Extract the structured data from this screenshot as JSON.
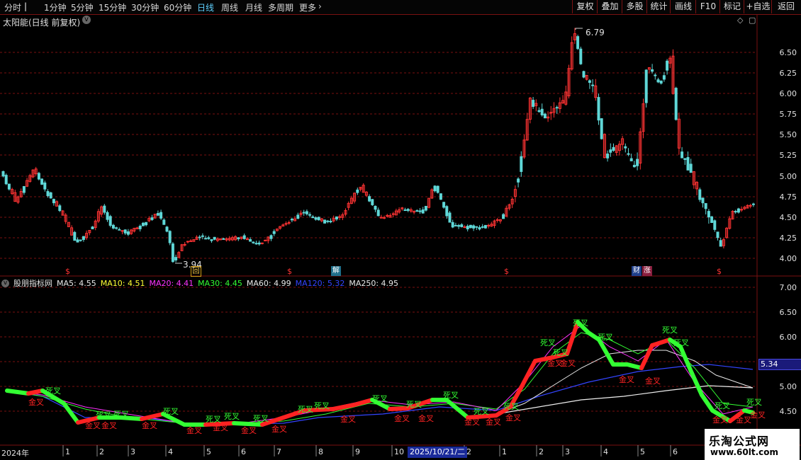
{
  "toolbar": {
    "periods": [
      "分时",
      "1分钟",
      "5分钟",
      "15分钟",
      "30分钟",
      "60分钟",
      "日线",
      "周线",
      "月线",
      "多周期",
      "更多"
    ],
    "active": "日线",
    "right_buttons": [
      "复权",
      "叠加",
      "多股",
      "统计",
      "画线",
      "F10",
      "标记",
      "+自选",
      "返回"
    ]
  },
  "main_chart": {
    "title": "太阳能(日线 前复权)",
    "high_label": "6.79",
    "low_label": "3.94",
    "price_ticks": [
      "6.50",
      "6.25",
      "6.00",
      "5.75",
      "5.50",
      "5.25",
      "5.00",
      "4.75",
      "4.50",
      "4.25",
      "4.00"
    ],
    "event_markers": [
      "回",
      "解",
      "财",
      "涨"
    ],
    "dollar_marker": "$"
  },
  "indicator": {
    "name": "股朋指标网",
    "legend": [
      {
        "label": "MA5:",
        "value": "4.55",
        "color": "#e8e8e8"
      },
      {
        "label": "MA10:",
        "value": "4.51",
        "color": "#ffff33"
      },
      {
        "label": "MA20:",
        "value": "4.41",
        "color": "#ff33ff"
      },
      {
        "label": "MA30:",
        "value": "4.45",
        "color": "#33ff33"
      },
      {
        "label": "MA60:",
        "value": "4.99",
        "color": "#e8e8e8"
      },
      {
        "label": "MA120:",
        "value": "5.32",
        "color": "#3344ff"
      },
      {
        "label": "MA250:",
        "value": "4.95",
        "color": "#e8e8e8"
      }
    ],
    "ticks": [
      "7.00",
      "6.50",
      "6.00",
      "5.50",
      "5.00",
      "4.50"
    ],
    "current_value_box": "5.34",
    "cross_up_label": "金叉",
    "cross_down_label": "死叉"
  },
  "timeline": {
    "year_label": "2024年",
    "months_2024": [
      "1",
      "2",
      "3",
      "4",
      "5",
      "6",
      "7",
      "8",
      "9",
      "10"
    ],
    "cursor_date": "2025/10/21/二",
    "months_2025": [
      "2",
      "1",
      "2",
      "3",
      "4",
      "5",
      "6"
    ]
  },
  "watermark": {
    "line1": "乐淘公式网",
    "line2": "www.60lt.com"
  },
  "colors": {
    "up": "#ff3333",
    "down": "#5fd7d7",
    "grid": "#7a1111",
    "gold": "#ff2222",
    "dead": "#33ff33"
  }
}
